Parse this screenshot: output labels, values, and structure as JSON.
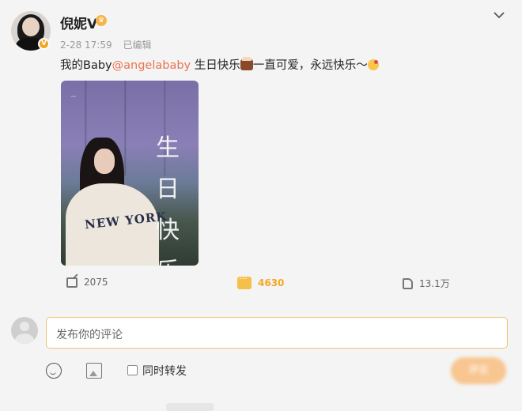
{
  "post": {
    "username": "倪妮V",
    "date": "2-28 17:59",
    "edited": "已编辑",
    "text_prefix": "我的Baby",
    "mention": "@angelababy",
    "text_mid": " 生日快乐",
    "text_mid2": "一直可爱，永远快乐～",
    "image_script_text": "生日快乐",
    "image_print_text": "NEW YORK"
  },
  "actions": {
    "shares": "2075",
    "comments": "4630",
    "likes": "13.1万"
  },
  "comment_box": {
    "placeholder": "发布你的评论",
    "forward_label": "同时转发",
    "submit_label": "评论"
  },
  "icons": {
    "expand": "chevron-down-icon",
    "verified": "verified-badge-icon",
    "crown": "crown-icon",
    "share": "share-icon",
    "comment": "comment-icon",
    "like": "like-icon",
    "emoji": "smile-icon",
    "image": "image-icon"
  },
  "colors": {
    "mention": "#eb7350",
    "accent": "#f5a623",
    "input_border": "#f1c270"
  }
}
